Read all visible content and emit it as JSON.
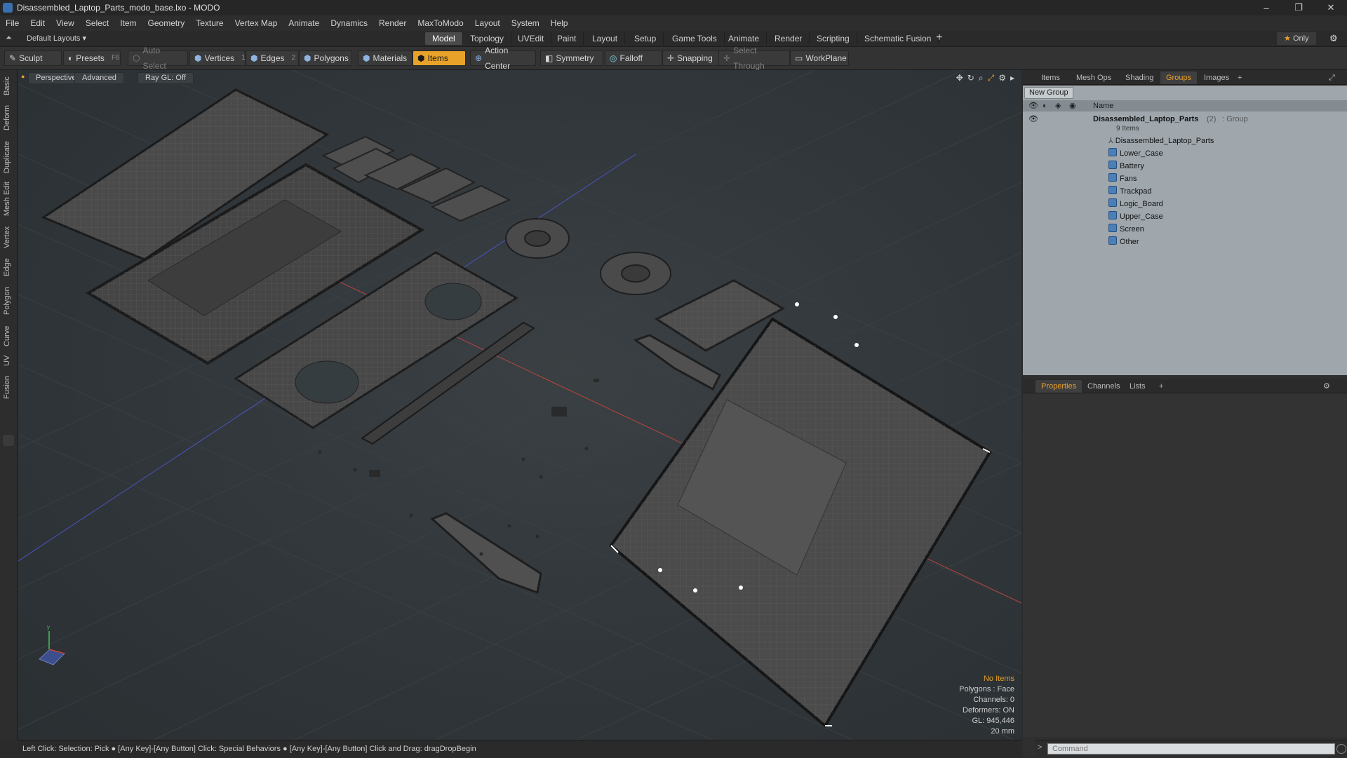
{
  "window": {
    "title": "Disassembled_Laptop_Parts_modo_base.lxo - MODO",
    "controls": [
      "–",
      "❐",
      "✕"
    ]
  },
  "menu": [
    "File",
    "Edit",
    "View",
    "Select",
    "Item",
    "Geometry",
    "Texture",
    "Vertex Map",
    "Animate",
    "Dynamics",
    "Render",
    "MaxToModo",
    "Layout",
    "System",
    "Help"
  ],
  "layout_row": {
    "preset": "Default Layouts",
    "tabs": [
      "Model",
      "Topology",
      "UVEdit",
      "Paint",
      "Layout",
      "Setup",
      "Game Tools",
      "Animate",
      "Render",
      "Scripting",
      "Schematic Fusion"
    ],
    "active_tab": "Model",
    "only_label": "Only"
  },
  "toolbar": {
    "sculpt": "Sculpt",
    "presets": "Presets",
    "presets_key": "F6",
    "auto_select": "Auto Select",
    "vertices": "Vertices",
    "vertices_key": "1",
    "edges": "Edges",
    "edges_key": "2",
    "polygons": "Polygons",
    "materials": "Materials",
    "items": "Items",
    "action_center": "Action Center",
    "symmetry": "Symmetry",
    "falloff": "Falloff",
    "snapping": "Snapping",
    "select_through": "Select Through",
    "workplane": "WorkPlane"
  },
  "left_tabs": [
    "Basic",
    "Deform",
    "Duplicate",
    "Mesh Edit",
    "Vertex",
    "Edge",
    "Polygon",
    "Curve",
    "UV",
    "Fusion"
  ],
  "viewport": {
    "view": "Perspective",
    "shading": "Advanced",
    "raygl": "Ray GL: Off",
    "stats": {
      "selection": "No Items",
      "polygons": "Polygons : Face",
      "channels": "Channels: 0",
      "deformers": "Deformers: ON",
      "gl": "GL: 945,446",
      "scale": "20 mm"
    }
  },
  "status_bar": "Left Click: Selection: Pick ● [Any Key]-[Any Button] Click: Special Behaviors ● [Any Key]-[Any Button] Click and Drag: dragDropBegin",
  "groups_panel": {
    "tabs": [
      "Items",
      "Mesh Ops",
      "Shading",
      "Groups",
      "Images"
    ],
    "active_tab": "Groups",
    "new_group": "New Group",
    "column_name": "Name",
    "group": {
      "name": "Disassembled_Laptop_Parts",
      "count": "(2)",
      "type": ": Group",
      "items_count": "9 Items"
    },
    "children": [
      "Disassembled_Laptop_Parts",
      "Lower_Case",
      "Battery",
      "Fans",
      "Trackpad",
      "Logic_Board",
      "Upper_Case",
      "Screen",
      "Other"
    ]
  },
  "properties_panel": {
    "tabs": [
      "Properties",
      "Channels",
      "Lists"
    ],
    "active_tab": "Properties"
  },
  "command": {
    "placeholder": "Command"
  },
  "colors": {
    "accent": "#e8a22a",
    "viewport_bg": "#30363a",
    "x_axis": "#c8423a",
    "z_axis": "#4a55c8",
    "groups_bg": "#9fa7ad"
  }
}
